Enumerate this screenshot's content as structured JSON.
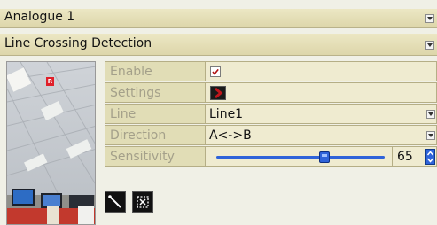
{
  "camera": {
    "label": "Analogue 1"
  },
  "detection": {
    "label": "Line Crossing Detection"
  },
  "preview": {
    "rec_badge": "R"
  },
  "settings": {
    "enable": {
      "label": "Enable",
      "checked": true
    },
    "settings": {
      "label": "Settings"
    },
    "line": {
      "label": "Line",
      "value": "Line1"
    },
    "direction": {
      "label": "Direction",
      "value": "A<->B"
    },
    "sensitivity": {
      "label": "Sensitivity",
      "value": "65",
      "max": 100
    }
  },
  "tools": [
    {
      "name": "draw-line-tool",
      "icon": "line-draw-icon"
    },
    {
      "name": "clear-tool",
      "icon": "clear-icon"
    }
  ],
  "colors": {
    "header_bar": "#e6e0b8",
    "rec_badge": "#e0202a",
    "slider_track": "#2f63d9",
    "settings_arrow": "#c0161c"
  }
}
